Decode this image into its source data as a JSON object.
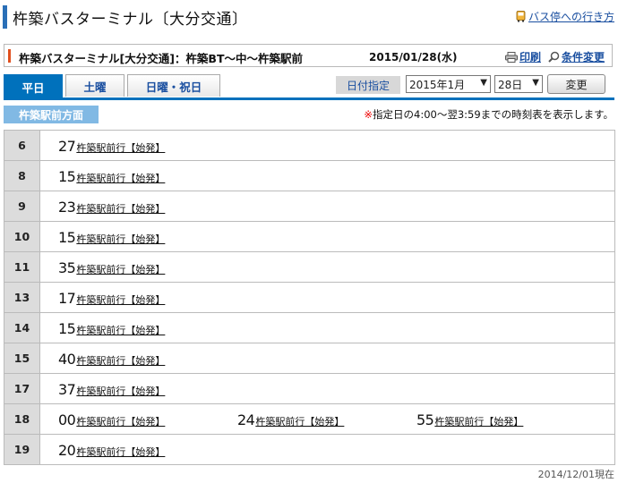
{
  "page_title": "杵築バスターミナル〔大分交通〕",
  "title_link": "バス停への行き方",
  "route_label": "杵築バスターミナル[大分交通]：杵築BT〜中〜杵築駅前",
  "route_date": "2015/01/28(水)",
  "print_label": "印刷",
  "condition_label": "条件変更",
  "tabs": [
    {
      "label": "平日",
      "active": true
    },
    {
      "label": "土曜",
      "active": false
    },
    {
      "label": "日曜・祝日",
      "active": false
    }
  ],
  "date_label": "日付指定",
  "month_select": "2015年1月",
  "day_select": "28日",
  "change_button": "変更",
  "direction_label": "杵築駅前方面",
  "notice_mark": "※",
  "notice_text": "指定日の4:00〜翌3:59までの時刻表を表示します。",
  "timetable": [
    {
      "hour": "6",
      "entries": [
        {
          "min": "27",
          "dest": "杵築駅前行【始発】"
        }
      ]
    },
    {
      "hour": "8",
      "entries": [
        {
          "min": "15",
          "dest": "杵築駅前行【始発】"
        }
      ]
    },
    {
      "hour": "9",
      "entries": [
        {
          "min": "23",
          "dest": "杵築駅前行【始発】"
        }
      ]
    },
    {
      "hour": "10",
      "entries": [
        {
          "min": "15",
          "dest": "杵築駅前行【始発】"
        }
      ]
    },
    {
      "hour": "11",
      "entries": [
        {
          "min": "35",
          "dest": "杵築駅前行【始発】"
        }
      ]
    },
    {
      "hour": "13",
      "entries": [
        {
          "min": "17",
          "dest": "杵築駅前行【始発】"
        }
      ]
    },
    {
      "hour": "14",
      "entries": [
        {
          "min": "15",
          "dest": "杵築駅前行【始発】"
        }
      ]
    },
    {
      "hour": "15",
      "entries": [
        {
          "min": "40",
          "dest": "杵築駅前行【始発】"
        }
      ]
    },
    {
      "hour": "17",
      "entries": [
        {
          "min": "37",
          "dest": "杵築駅前行【始発】"
        }
      ]
    },
    {
      "hour": "18",
      "entries": [
        {
          "min": "00",
          "dest": "杵築駅前行【始発】"
        },
        {
          "min": "24",
          "dest": "杵築駅前行【始発】"
        },
        {
          "min": "55",
          "dest": "杵築駅前行【始発】"
        }
      ]
    },
    {
      "hour": "19",
      "entries": [
        {
          "min": "20",
          "dest": "杵築駅前行【始発】"
        }
      ]
    }
  ],
  "footer_text": "2014/12/01現在",
  "colors": {
    "accent": "#0071bc",
    "direction_bg": "#81b9e4",
    "notice_mark": "#e00000",
    "route_accent": "#e0501f"
  }
}
